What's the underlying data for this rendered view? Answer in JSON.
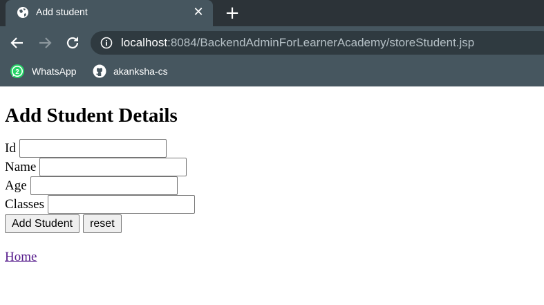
{
  "tab": {
    "title": "Add student",
    "favicon": "globe-icon"
  },
  "address_bar": {
    "host": "localhost",
    "path": ":8084/BackendAdminForLearnerAcademy/storeStudent.jsp"
  },
  "bookmarks": [
    {
      "label": "WhatsApp",
      "icon": "whatsapp-icon",
      "badge": "2"
    },
    {
      "label": "akanksha-cs",
      "icon": "github-icon"
    }
  ],
  "page": {
    "heading": "Add Student Details",
    "fields": [
      {
        "label": "Id",
        "value": ""
      },
      {
        "label": "Name",
        "value": ""
      },
      {
        "label": "Age",
        "value": ""
      },
      {
        "label": "Classes",
        "value": ""
      }
    ],
    "submit_label": "Add Student",
    "reset_label": "reset",
    "home_link": "Home"
  },
  "colors": {
    "chrome_dark": "#2c3338",
    "chrome": "#46565f",
    "whatsapp_green": "#25d366",
    "visited_link": "#551a8b"
  }
}
